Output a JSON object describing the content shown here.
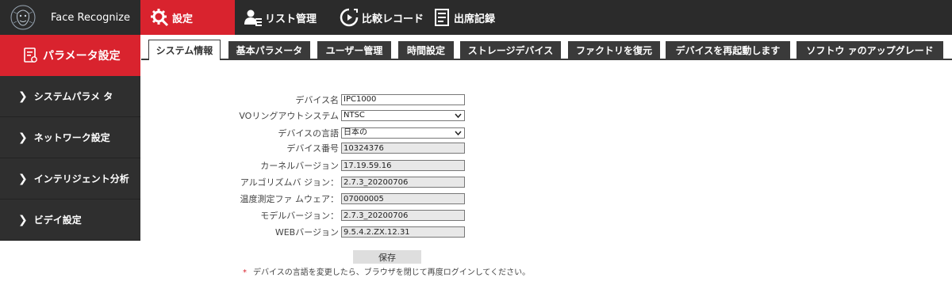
{
  "app": {
    "title": "Face Recognize"
  },
  "nav": {
    "items": [
      {
        "label": "設定",
        "icon": "gear-icon"
      },
      {
        "label": "リスト管理",
        "icon": "user-list-icon"
      },
      {
        "label": "比較レコード",
        "icon": "compare-icon"
      },
      {
        "label": "出席記録",
        "icon": "document-icon"
      }
    ]
  },
  "sidebar": {
    "header": "パラメータ設定",
    "items": [
      {
        "label": "システムパラメ タ"
      },
      {
        "label": "ネットワーク設定"
      },
      {
        "label": "インテリジェント分析"
      },
      {
        "label": "ビデイ設定"
      }
    ]
  },
  "tabs": [
    {
      "label": "システム情報"
    },
    {
      "label": "基本パラメータ"
    },
    {
      "label": "ユーザー管理"
    },
    {
      "label": "時間設定"
    },
    {
      "label": "ストレージデバイス"
    },
    {
      "label": "ファクトリを復元"
    },
    {
      "label": "デバイスを再起動します"
    },
    {
      "label": "ソフトウ ァのアップグレード"
    }
  ],
  "form": {
    "device_name": {
      "label": "デバイス名",
      "value": "IPC1000"
    },
    "vo_output": {
      "label": "VOリングアウトシステム",
      "value": "NTSC"
    },
    "language": {
      "label": "デバイスの言語",
      "value": "日本の"
    },
    "device_number": {
      "label": "デバイス番号",
      "value": "10324376"
    },
    "kernel_version": {
      "label": "カーネルバージョン",
      "value": "17.19.59.16"
    },
    "algorithm_version": {
      "label": "アルゴリズムバ ジョン：",
      "value": "2.7.3_20200706"
    },
    "temp_firmware": {
      "label": "温度測定ファ ムウェア：",
      "value": "07000005"
    },
    "model_version": {
      "label": "モデルバージョン：",
      "value": "2.7.3_20200706"
    },
    "web_version": {
      "label": "WEBバージョン",
      "value": "9.5.4.2.ZX.12.31"
    }
  },
  "save_label": "保存",
  "note": {
    "star": "*",
    "text": "デバイスの言語を変更したら、ブラウザを閉じて再度ログインしてください。"
  },
  "colors": {
    "accent": "#d9232e",
    "topbar": "#2b2b2b",
    "sidebar": "#2f2f2f",
    "tab": "#3a3a3a"
  }
}
